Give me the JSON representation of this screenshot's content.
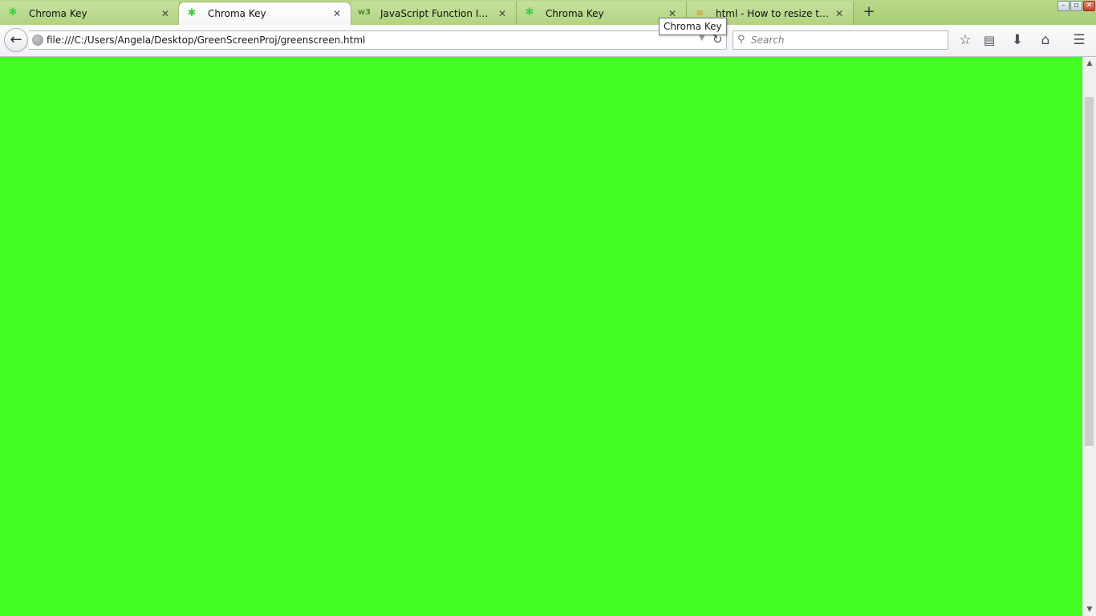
{
  "tabs": [
    {
      "title": "Chroma Key",
      "favicon": "chroma-key-icon",
      "active": false
    },
    {
      "title": "Chroma Key",
      "favicon": "chroma-key-icon",
      "active": true
    },
    {
      "title": "JavaScript Function Invoca...",
      "favicon": "w3schools-icon",
      "active": false
    },
    {
      "title": "Chroma Key",
      "favicon": "chroma-key-icon",
      "active": false
    },
    {
      "title": "html - How to resize the vi...",
      "favicon": "stackoverflow-icon",
      "active": false
    }
  ],
  "tooltip": "Chroma Key",
  "navbar": {
    "url": "file:///C:/Users/Angela/Desktop/GreenScreenProj/greenscreen.html",
    "search_placeholder": "Search"
  },
  "content": {
    "background_color": "#43ff21"
  },
  "colors": {
    "tabstrip": "#b2d381",
    "page_green": "#43ff21"
  }
}
